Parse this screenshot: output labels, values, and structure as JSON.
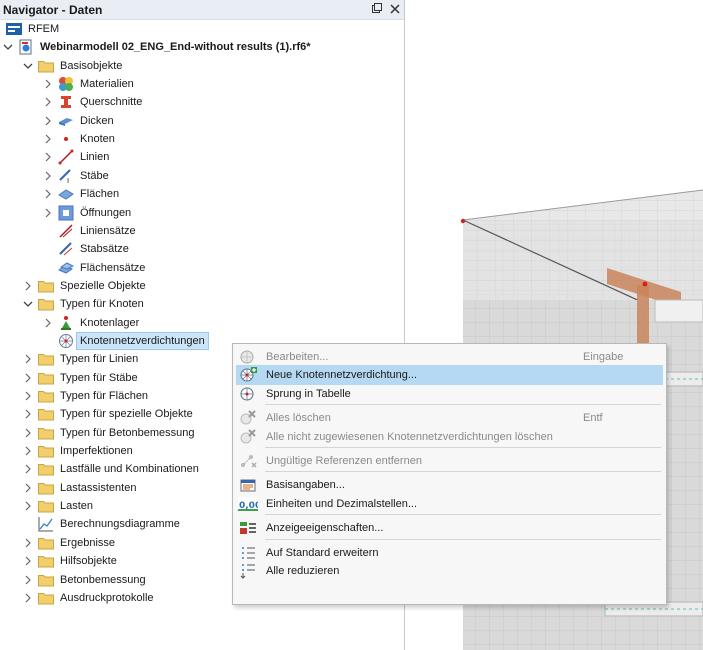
{
  "navigator": {
    "title": "Navigator - Daten",
    "pin_icon": "pin-icon",
    "close_icon": "close-icon"
  },
  "tree": [
    {
      "label": "RFEM",
      "level": 0,
      "toggle": "none",
      "icon": "rfem-logo-icon"
    },
    {
      "label": "Webinarmodell 02_ENG_End-without results (1).rf6*",
      "level": 0,
      "toggle": "expanded",
      "icon": "model-file-icon",
      "bold": true
    },
    {
      "label": "Basisobjekte",
      "level": 1,
      "toggle": "expanded",
      "icon": "folder-icon"
    },
    {
      "label": "Materialien",
      "level": 2,
      "toggle": "collapsed",
      "icon": "materials-icon"
    },
    {
      "label": "Querschnitte",
      "level": 2,
      "toggle": "collapsed",
      "icon": "cross-section-icon"
    },
    {
      "label": "Dicken",
      "level": 2,
      "toggle": "collapsed",
      "icon": "thickness-icon"
    },
    {
      "label": "Knoten",
      "level": 2,
      "toggle": "collapsed",
      "icon": "node-icon"
    },
    {
      "label": "Linien",
      "level": 2,
      "toggle": "collapsed",
      "icon": "line-icon"
    },
    {
      "label": "Stäbe",
      "level": 2,
      "toggle": "collapsed",
      "icon": "member-icon"
    },
    {
      "label": "Flächen",
      "level": 2,
      "toggle": "collapsed",
      "icon": "surface-icon"
    },
    {
      "label": "Öffnungen",
      "level": 2,
      "toggle": "collapsed",
      "icon": "opening-icon"
    },
    {
      "label": "Liniensätze",
      "level": 2,
      "toggle": "none",
      "icon": "line-set-icon"
    },
    {
      "label": "Stabsätze",
      "level": 2,
      "toggle": "none",
      "icon": "member-set-icon"
    },
    {
      "label": "Flächensätze",
      "level": 2,
      "toggle": "none",
      "icon": "surface-set-icon"
    },
    {
      "label": "Spezielle Objekte",
      "level": 1,
      "toggle": "collapsed",
      "icon": "folder-icon"
    },
    {
      "label": "Typen für Knoten",
      "level": 1,
      "toggle": "expanded",
      "icon": "folder-icon"
    },
    {
      "label": "Knotenlager",
      "level": 2,
      "toggle": "collapsed",
      "icon": "nodal-support-icon"
    },
    {
      "label": "Knotennetzverdichtungen",
      "level": 2,
      "toggle": "none",
      "icon": "mesh-refinement-icon",
      "selected": true
    },
    {
      "label": "Typen für Linien",
      "level": 1,
      "toggle": "collapsed",
      "icon": "folder-icon"
    },
    {
      "label": "Typen für Stäbe",
      "level": 1,
      "toggle": "collapsed",
      "icon": "folder-icon"
    },
    {
      "label": "Typen für Flächen",
      "level": 1,
      "toggle": "collapsed",
      "icon": "folder-icon"
    },
    {
      "label": "Typen für spezielle Objekte",
      "level": 1,
      "toggle": "collapsed",
      "icon": "folder-icon"
    },
    {
      "label": "Typen für Betonbemessung",
      "level": 1,
      "toggle": "collapsed",
      "icon": "folder-icon"
    },
    {
      "label": "Imperfektionen",
      "level": 1,
      "toggle": "collapsed",
      "icon": "folder-icon"
    },
    {
      "label": "Lastfälle und Kombinationen",
      "level": 1,
      "toggle": "collapsed",
      "icon": "folder-icon"
    },
    {
      "label": "Lastassistenten",
      "level": 1,
      "toggle": "collapsed",
      "icon": "folder-icon"
    },
    {
      "label": "Lasten",
      "level": 1,
      "toggle": "collapsed",
      "icon": "folder-icon"
    },
    {
      "label": "Berechnungsdiagramme",
      "level": 1,
      "toggle": "none",
      "icon": "diagram-icon"
    },
    {
      "label": "Ergebnisse",
      "level": 1,
      "toggle": "collapsed",
      "icon": "folder-icon"
    },
    {
      "label": "Hilfsobjekte",
      "level": 1,
      "toggle": "collapsed",
      "icon": "folder-icon"
    },
    {
      "label": "Betonbemessung",
      "level": 1,
      "toggle": "collapsed",
      "icon": "folder-icon"
    },
    {
      "label": "Ausdruckprotokolle",
      "level": 1,
      "toggle": "collapsed",
      "icon": "folder-icon"
    }
  ],
  "context_menu": {
    "items": [
      {
        "label": "Bearbeiten...",
        "shortcut": "Eingabe",
        "icon": "edit-icon",
        "disabled": true
      },
      {
        "label": "Neue Knotennetzverdichtung...",
        "shortcut": "",
        "icon": "new-mesh-refinement-icon",
        "hover": true
      },
      {
        "label": "Sprung in Tabelle",
        "shortcut": "",
        "icon": "jump-to-table-icon"
      },
      {
        "sep": true
      },
      {
        "label": "Alles löschen",
        "shortcut": "Entf",
        "icon": "delete-all-icon",
        "disabled": true
      },
      {
        "label": "Alle nicht zugewiesenen Knotennetzverdichtungen löschen",
        "shortcut": "",
        "icon": "delete-unassigned-icon",
        "disabled": true
      },
      {
        "sep": true
      },
      {
        "label": "Ungültige Referenzen entfernen",
        "shortcut": "",
        "icon": "remove-invalid-references-icon",
        "disabled": true
      },
      {
        "sep": true
      },
      {
        "label": "Basisangaben...",
        "shortcut": "",
        "icon": "base-data-icon"
      },
      {
        "label": "Einheiten und Dezimalstellen...",
        "shortcut": "",
        "icon": "units-decimals-icon",
        "icon_text": "0,00"
      },
      {
        "sep": true
      },
      {
        "label": "Anzeigeeigenschaften...",
        "shortcut": "",
        "icon": "display-properties-icon"
      },
      {
        "sep": true
      },
      {
        "label": "Auf Standard erweitern",
        "shortcut": "",
        "icon": "expand-default-icon"
      },
      {
        "label": "Alle reduzieren",
        "shortcut": "",
        "icon": "collapse-all-icon"
      }
    ]
  },
  "colors": {
    "selection": "#cce4f7",
    "menu_hover": "#b6d9f3",
    "folder": "#f3cf6b",
    "model_face_front": "#dcdcdc",
    "model_face_top": "#e9e9e9",
    "highlight_member": "#c9845a"
  }
}
